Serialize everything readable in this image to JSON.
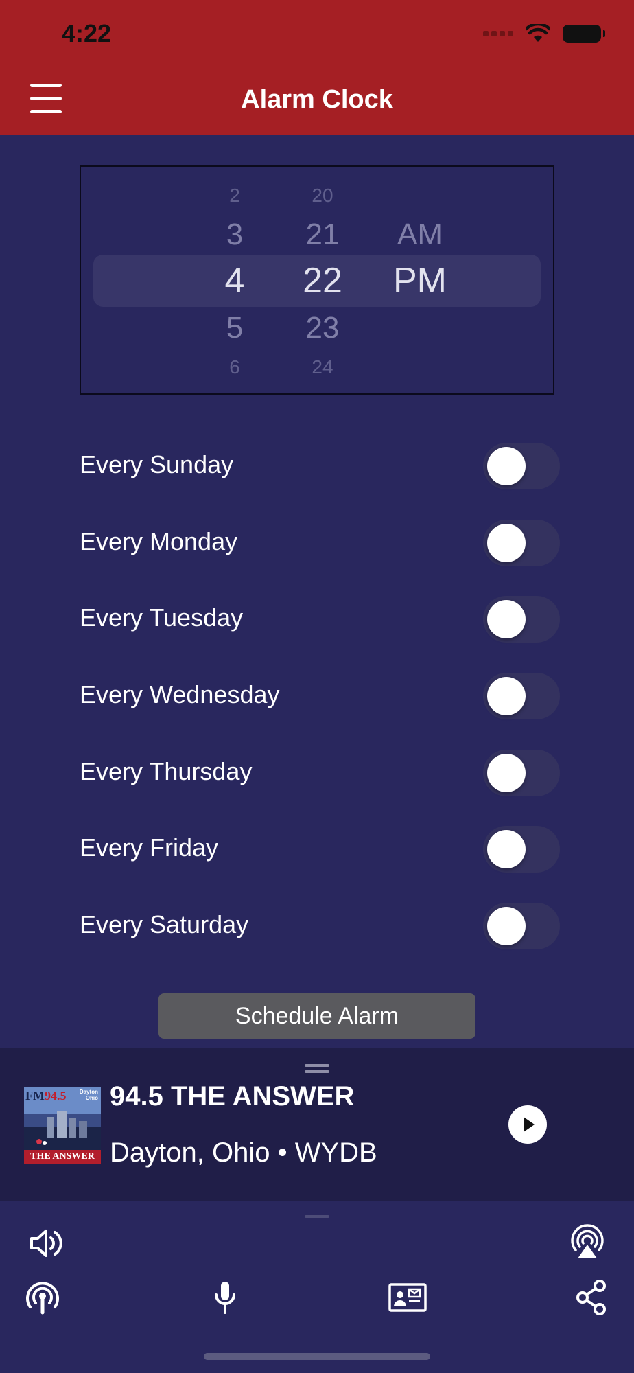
{
  "status_bar": {
    "time": "4:22"
  },
  "header": {
    "title": "Alarm Clock"
  },
  "picker": {
    "hours": [
      "2",
      "3",
      "4",
      "5",
      "6"
    ],
    "minutes": [
      "20",
      "21",
      "22",
      "23",
      "24"
    ],
    "periods": [
      "AM",
      "PM"
    ],
    "selected": {
      "hour": "4",
      "minute": "22",
      "period": "PM"
    }
  },
  "days": [
    {
      "label": "Every Sunday",
      "on": false
    },
    {
      "label": "Every Monday",
      "on": false
    },
    {
      "label": "Every Tuesday",
      "on": false
    },
    {
      "label": "Every Wednesday",
      "on": false
    },
    {
      "label": "Every Thursday",
      "on": false
    },
    {
      "label": "Every Friday",
      "on": false
    },
    {
      "label": "Every Saturday",
      "on": false
    }
  ],
  "schedule_button": {
    "label": "Schedule Alarm"
  },
  "now_playing": {
    "station": "94.5 THE ANSWER",
    "subtitle": "Dayton, Ohio • WYDB",
    "logo_text": {
      "fm": "FM",
      "freq": "94.5",
      "city": "Dayton",
      "state": "Ohio",
      "banner": "THE ANSWER"
    }
  },
  "toolbar_icons": [
    "volume-icon",
    "airplay-icon",
    "podcast-icon",
    "microphone-icon",
    "contact-card-icon",
    "share-icon"
  ],
  "colors": {
    "header": "#a51f24",
    "background": "#29275e",
    "now_playing_bg": "#201e48",
    "button_gray": "#5a5a5e",
    "toggle_off": "#34325f"
  }
}
